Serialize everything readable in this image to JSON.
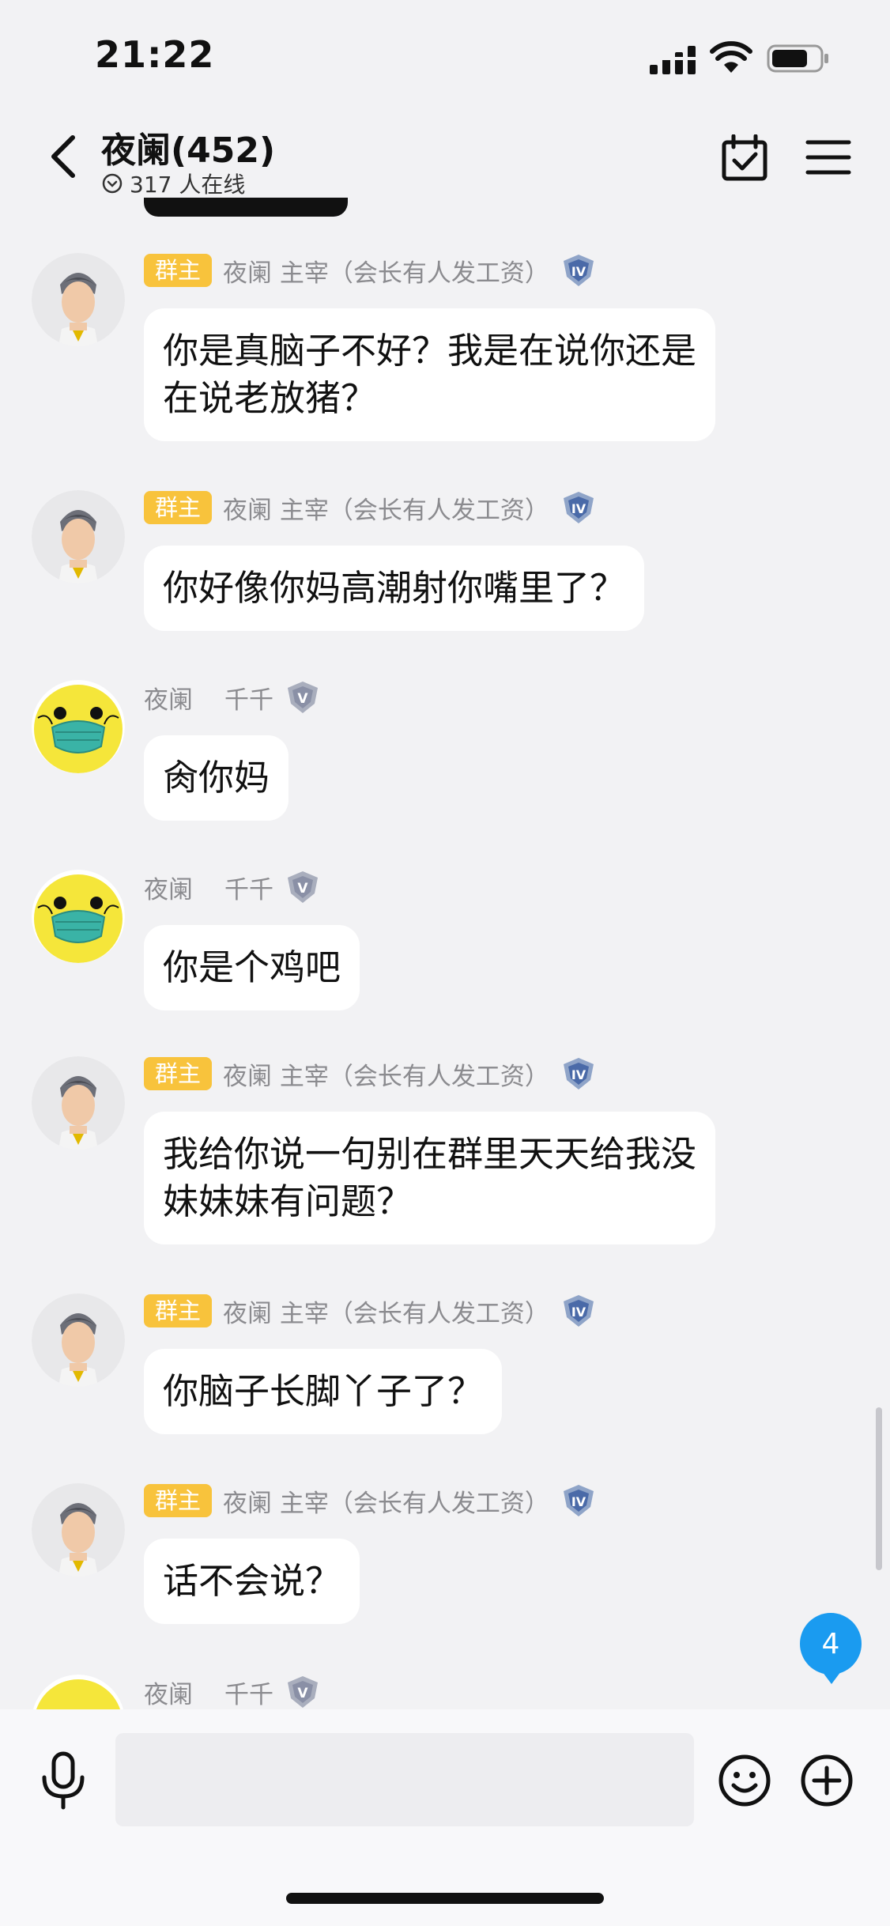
{
  "status_bar": {
    "time": "21:22"
  },
  "header": {
    "title": "夜阑(452)",
    "online_text": "317 人在线"
  },
  "messages": [
    {
      "avatar": "male-avatar",
      "badge": "群主",
      "sender": "夜阑 主宰（会长有人发工资）",
      "text_lines": [
        "你是真脑子不好？我是在说你还是",
        "在说老放猪？"
      ]
    },
    {
      "avatar": "male-avatar",
      "badge": "群主",
      "sender": "夜阑 主宰（会长有人发工资）",
      "text_lines": [
        "你好像你妈高潮射你嘴里了？"
      ]
    },
    {
      "avatar": "duck-avatar",
      "badge": "",
      "sender_group": "夜阑",
      "sender_name": "千千",
      "text_lines": [
        "肏你妈"
      ]
    },
    {
      "avatar": "duck-avatar",
      "badge": "",
      "sender_group": "夜阑",
      "sender_name": "千千",
      "text_lines": [
        "你是个鸡吧"
      ]
    },
    {
      "avatar": "male-avatar",
      "badge": "群主",
      "sender": "夜阑 主宰（会长有人发工资）",
      "text_lines": [
        "我给你说一句别在群里天天给我没",
        "妹妹妹有问题？"
      ]
    },
    {
      "avatar": "male-avatar",
      "badge": "群主",
      "sender": "夜阑 主宰（会长有人发工资）",
      "text_lines": [
        "你脑子长脚丫子了？"
      ]
    },
    {
      "avatar": "male-avatar",
      "badge": "群主",
      "sender": "夜阑 主宰（会长有人发工资）",
      "text_lines": [
        "话不会说？"
      ]
    },
    {
      "avatar": "duck-avatar",
      "badge": "",
      "sender_group": "夜阑",
      "sender_name": "千千",
      "text_lines": []
    }
  ],
  "unread_count": "4",
  "input": {
    "value": "",
    "placeholder": ""
  },
  "colors": {
    "owner_badge": "#f8c33c",
    "unread_badge": "#1a9bf0",
    "background": "#f2f2f4"
  }
}
